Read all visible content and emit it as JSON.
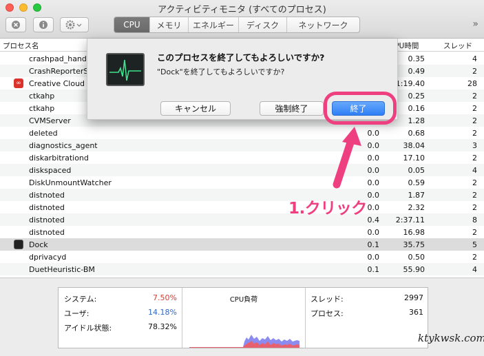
{
  "window": {
    "title": "アクティビティモニタ (すべてのプロセス)"
  },
  "toolbar": {
    "tabs": [
      {
        "label": "CPU",
        "active": true
      },
      {
        "label": "メモリ",
        "active": false
      },
      {
        "label": "エネルギー",
        "active": false
      },
      {
        "label": "ディスク",
        "active": false
      },
      {
        "label": "ネットワーク",
        "active": false
      }
    ],
    "overflow": "»"
  },
  "table": {
    "headers": {
      "name": "プロセス名",
      "time": "CPU時間",
      "threads": "スレッド"
    },
    "rows": [
      {
        "name": "crashpad_handl",
        "cpu": "",
        "time": "0.35",
        "threads": "4"
      },
      {
        "name": "CrashReporterS",
        "cpu": "",
        "time": "0.49",
        "threads": "2"
      },
      {
        "name": "Creative Cloud",
        "cpu": "",
        "time": "21:19.40",
        "threads": "28",
        "icon": "creative-cloud-icon"
      },
      {
        "name": "ctkahp",
        "cpu": "",
        "time": "0.25",
        "threads": "2"
      },
      {
        "name": "ctkahp",
        "cpu": "",
        "time": "0.16",
        "threads": "2"
      },
      {
        "name": "CVMServer",
        "cpu": "",
        "time": "1.28",
        "threads": "2"
      },
      {
        "name": "deleted",
        "cpu": "0.0",
        "time": "0.68",
        "threads": "2"
      },
      {
        "name": "diagnostics_agent",
        "cpu": "0.0",
        "time": "38.04",
        "threads": "3"
      },
      {
        "name": "diskarbitrationd",
        "cpu": "0.0",
        "time": "17.10",
        "threads": "2"
      },
      {
        "name": "diskspaced",
        "cpu": "0.0",
        "time": "0.05",
        "threads": "4"
      },
      {
        "name": "DiskUnmountWatcher",
        "cpu": "0.0",
        "time": "0.59",
        "threads": "2"
      },
      {
        "name": "distnoted",
        "cpu": "0.0",
        "time": "1.87",
        "threads": "2"
      },
      {
        "name": "distnoted",
        "cpu": "0.0",
        "time": "2.32",
        "threads": "2"
      },
      {
        "name": "distnoted",
        "cpu": "0.4",
        "time": "2:37.11",
        "threads": "8"
      },
      {
        "name": "distnoted",
        "cpu": "0.0",
        "time": "16.98",
        "threads": "2"
      },
      {
        "name": "Dock",
        "cpu": "0.1",
        "time": "35.75",
        "threads": "5",
        "icon": "dock-icon",
        "selected": true
      },
      {
        "name": "dprivacyd",
        "cpu": "0.0",
        "time": "0.50",
        "threads": "2"
      },
      {
        "name": "DuetHeuristic-BM",
        "cpu": "0.1",
        "time": "55.90",
        "threads": "4"
      }
    ]
  },
  "dialog": {
    "title": "このプロセスを終了してもよろしいですか?",
    "message": "\"Dock\"を終了してもよろしいですか?",
    "cancel": "キャンセル",
    "force_quit": "強制終了",
    "quit": "終了"
  },
  "annotation": {
    "step": "1.クリック",
    "color": "#ee3f80"
  },
  "stats": {
    "system_label": "システム:",
    "system_value": "7.50%",
    "system_color": "#d23b32",
    "user_label": "ユーザ:",
    "user_value": "14.18%",
    "user_color": "#2f68c9",
    "idle_label": "アイドル状態:",
    "idle_value": "78.32%",
    "graph_title": "CPU負荷",
    "threads_label": "スレッド:",
    "threads_value": "2997",
    "processes_label": "プロセス:",
    "processes_value": "361"
  },
  "watermark": "ktykwsk.com"
}
